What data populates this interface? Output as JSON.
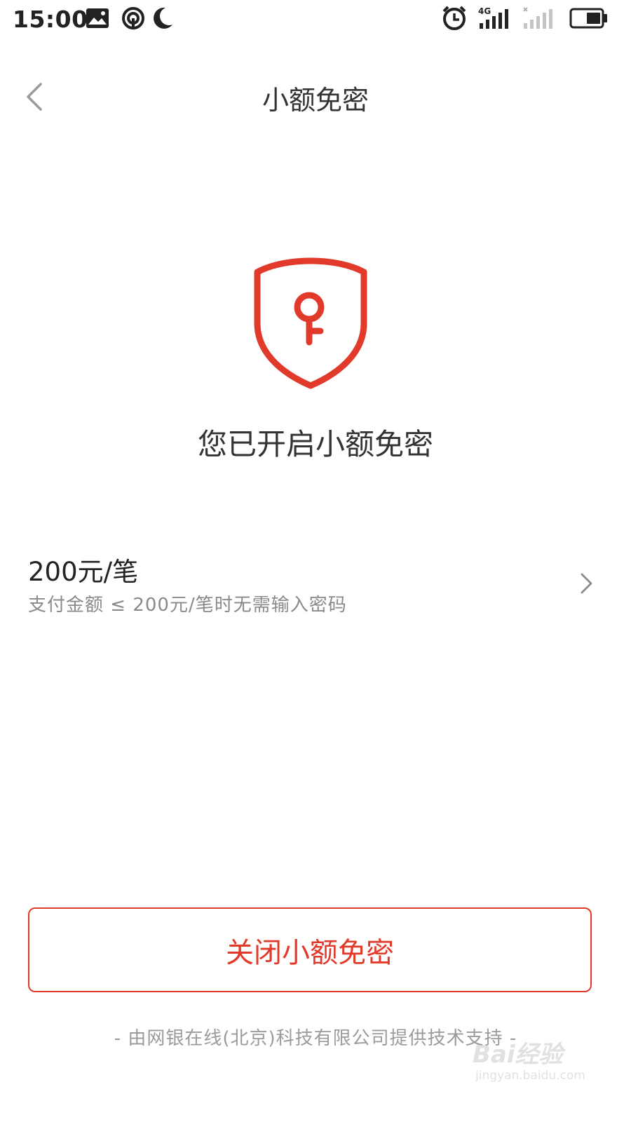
{
  "status_bar": {
    "time": "15:00",
    "network": "4G",
    "icons": [
      "photo-icon",
      "hotspot-icon",
      "moon-icon",
      "alarm-icon",
      "signal-icon",
      "signal-empty-icon",
      "battery-icon"
    ]
  },
  "header": {
    "title": "小额免密",
    "back_icon": "chevron-left-icon"
  },
  "main": {
    "shield_icon": "shield-key-icon",
    "status_message": "您已开启小额免密",
    "limit": {
      "amount": "200元/笔",
      "description": "支付金额 ≤ 200元/笔时无需输入密码",
      "chevron_icon": "chevron-right-icon"
    }
  },
  "actions": {
    "close_label": "关闭小额免密"
  },
  "footer": {
    "text": "-  由网银在线(北京)科技有限公司提供技术支持  -"
  },
  "watermark": {
    "brand": "Bai经验",
    "site": "jingyan.baidu.com"
  },
  "colors": {
    "accent": "#e23a2a",
    "text_primary": "#333333",
    "text_secondary": "#8a8a8a",
    "background": "#ffffff"
  }
}
